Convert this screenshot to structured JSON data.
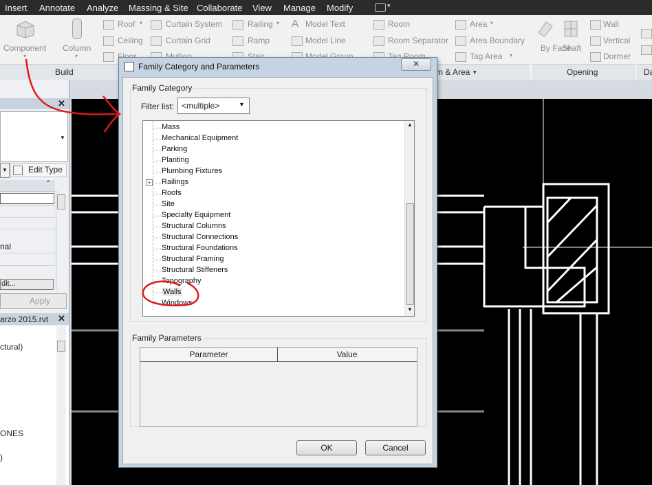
{
  "menubar": {
    "items": [
      "Insert",
      "Annotate",
      "Analyze",
      "Massing & Site",
      "Collaborate",
      "View",
      "Manage",
      "Modify"
    ]
  },
  "ribbon": {
    "component_label": "Component",
    "column_label": "Column",
    "build_items": [
      "Roof",
      "Ceiling",
      "Floor",
      "Curtain System",
      "Curtain Grid",
      "Mullion",
      "Railing",
      "Ramp",
      "Stair",
      "Model Text",
      "Model Line",
      "Model Group"
    ],
    "room_items": [
      "Room",
      "Room Separator",
      "Tag Room",
      "Area",
      "Area Boundary",
      "Tag Area"
    ],
    "panel_build": "Build",
    "panel_room_area": "m & Area",
    "opening": {
      "by_face": "By Face",
      "shaft": "Shaft",
      "wall": "Wall",
      "vertical": "Vertical",
      "dormer": "Dormer"
    },
    "panel_opening": "Opening",
    "panel_datum": "Da"
  },
  "properties": {
    "edit_type": "Edit Type",
    "field_value": "nal",
    "edit_button": "dit...",
    "apply": "Apply",
    "project_file": "arzo 2015.rvt",
    "browser_items": [
      "ctural)",
      "ONES",
      ")"
    ]
  },
  "dialog": {
    "title": "Family Category and Parameters",
    "close": "✕",
    "family_category_legend": "Family Category",
    "filter_label": "Filter list:",
    "filter_value": "<multiple>",
    "categories": [
      "Mass",
      "Mechanical Equipment",
      "Parking",
      "Planting",
      "Plumbing Fixtures",
      "Railings",
      "Roofs",
      "Site",
      "Specialty Equipment",
      "Structural Columns",
      "Structural Connections",
      "Structural Foundations",
      "Structural Framing",
      "Structural Stiffeners",
      "Topography",
      "Walls",
      "Windows"
    ],
    "selected_category": "Walls",
    "family_parameters_legend": "Family Parameters",
    "col_parameter": "Parameter",
    "col_value": "Value",
    "ok": "OK",
    "cancel": "Cancel"
  },
  "colors": {
    "annotation_red": "#e0181b",
    "canvas_bg": "#000000"
  }
}
